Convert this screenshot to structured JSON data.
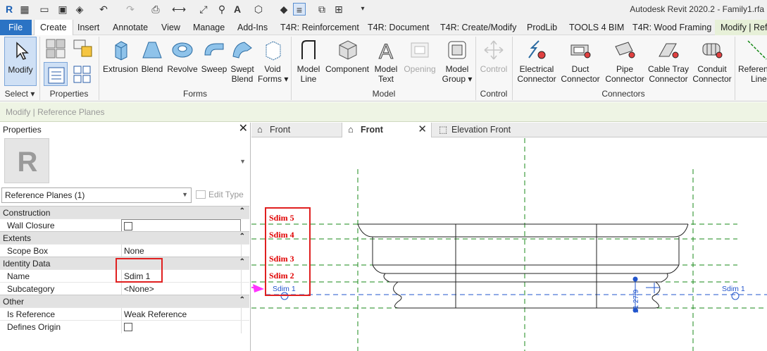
{
  "window": {
    "title": "Autodesk Revit 2020.2 - Family1.rfa"
  },
  "ribbon": {
    "tabs": [
      "File",
      "Create",
      "Insert",
      "Annotate",
      "View",
      "Manage",
      "Add-Ins",
      "T4R: Reinforcement",
      "T4R: Document",
      "T4R: Create/Modify",
      "ProdLib",
      "TOOLS 4 BIM",
      "T4R: Wood Framing",
      "Modify | Refe"
    ],
    "active_tab": "Create",
    "select": {
      "modify": "Modify",
      "select": "Select ▾"
    },
    "properties_panel": "Properties",
    "forms": {
      "title": "Forms",
      "extrusion": "Extrusion",
      "blend": "Blend",
      "revolve": "Revolve",
      "sweep": "Sweep",
      "swept_blend_1": "Swept",
      "swept_blend_2": "Blend",
      "void_1": "Void",
      "void_2": "Forms ▾"
    },
    "model": {
      "title": "Model",
      "line_1": "Model",
      "line_2": "Line",
      "component": "Component",
      "text_1": "Model",
      "text_2": "Text",
      "opening": "Opening",
      "group_1": "Model",
      "group_2": "Group ▾"
    },
    "control": {
      "title": "Control",
      "control": "Control"
    },
    "connectors": {
      "title": "Connectors",
      "electrical_1": "Electrical",
      "electrical_2": "Connector",
      "duct_1": "Duct",
      "duct_2": "Connector",
      "pipe_1": "Pipe",
      "pipe_2": "Connector",
      "cable_1": "Cable Tray",
      "cable_2": "Connector",
      "conduit_1": "Conduit",
      "conduit_2": "Connector"
    },
    "datum": {
      "ref_1": "Referen",
      "ref_2": "Line"
    }
  },
  "options_bar": {
    "text": "Modify | Reference Planes"
  },
  "properties": {
    "title": "Properties",
    "type_selector": "Reference Planes (1)",
    "edit_type": "Edit Type",
    "groups": [
      {
        "name": "Construction",
        "rows": [
          {
            "key": "Wall Closure",
            "value": ""
          }
        ]
      },
      {
        "name": "Extents",
        "rows": [
          {
            "key": "Scope Box",
            "value": "None"
          }
        ]
      },
      {
        "name": "Identity Data",
        "rows": [
          {
            "key": "Name",
            "value": "Sdim 1"
          },
          {
            "key": "Subcategory",
            "value": "<None>"
          }
        ]
      },
      {
        "name": "Other",
        "rows": [
          {
            "key": "Is Reference",
            "value": "Weak Reference"
          },
          {
            "key": "Defines Origin",
            "value": ""
          }
        ]
      }
    ]
  },
  "view_tabs": [
    "Front",
    "Front",
    "Elevation Front"
  ],
  "annotations": {
    "sdim5": "Sdim 5",
    "sdim4": "Sdim 4",
    "sdim3": "Sdim 3",
    "sdim2": "Sdim 2"
  },
  "drawing": {
    "plane_label_left": "Sdim 1",
    "plane_label_right": "Sdim 1",
    "dimension_value": "21 27/9"
  },
  "colors": {
    "file_tab": "#2b73c4",
    "context_tab": "#e7f0d8",
    "highlight_red": "#e02020",
    "arrow_magenta": "#ff33ff",
    "ref_plane_green": "#1a8a1a",
    "selection_blue": "#2255cc"
  }
}
